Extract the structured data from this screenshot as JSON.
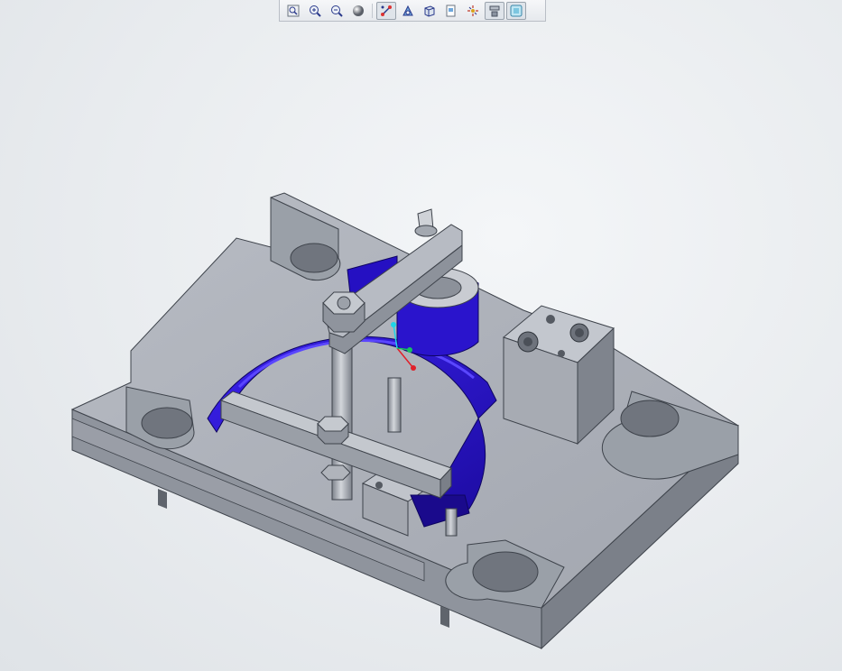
{
  "toolbar": {
    "buttons": [
      {
        "icon": "zoom-fit-icon",
        "active": false
      },
      {
        "icon": "zoom-in-icon",
        "active": false
      },
      {
        "icon": "zoom-out-icon",
        "active": false
      },
      {
        "icon": "shading-sphere-icon",
        "active": false
      },
      {
        "icon": "datum-axes-icon",
        "active": true
      },
      {
        "icon": "view-orient-icon",
        "active": false
      },
      {
        "icon": "view-cube-icon",
        "active": false
      },
      {
        "icon": "saved-views-icon",
        "active": false
      },
      {
        "icon": "spin-center-icon",
        "active": false
      },
      {
        "icon": "display-style-icon",
        "active": true
      },
      {
        "icon": "model-display-icon",
        "active": true
      }
    ]
  },
  "model": {
    "base_color": "#a9adb6",
    "base_shade_color": "#8d929b",
    "highlight_color": "#2d14d9",
    "highlight_shade_color": "#1a0a8c",
    "triad_colors": {
      "x": "#e0202a",
      "y": "#16c060",
      "z": "#1fd4e8"
    }
  }
}
